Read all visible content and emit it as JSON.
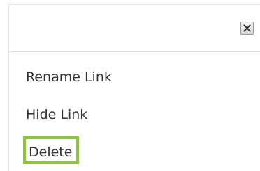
{
  "dialog": {
    "close_icon": "close-icon"
  },
  "menu": {
    "items": [
      {
        "label": "Rename Link"
      },
      {
        "label": "Hide Link"
      },
      {
        "label": "Delete",
        "highlighted": true
      }
    ],
    "highlight_color": "#8cc63f"
  }
}
